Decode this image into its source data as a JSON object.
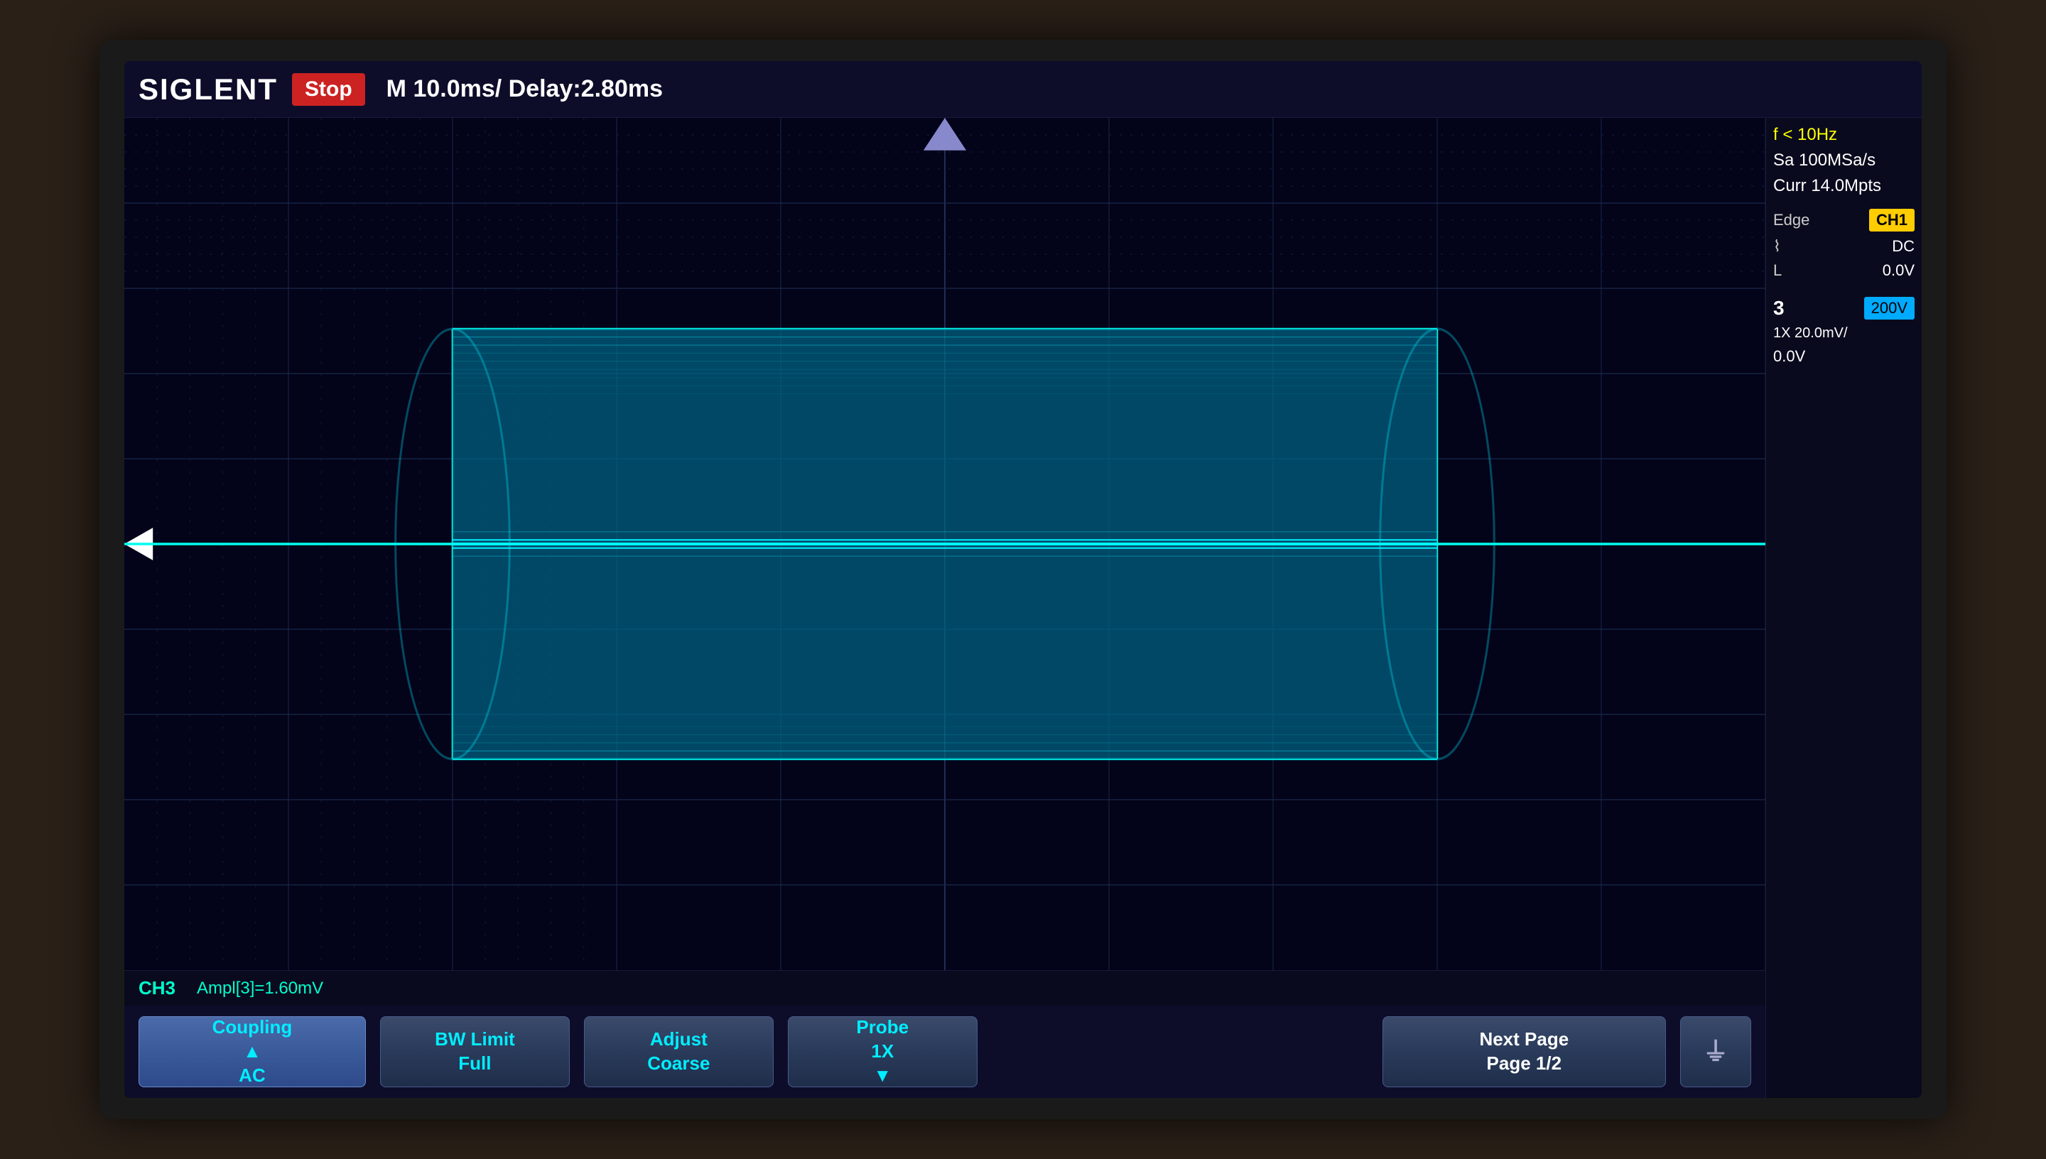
{
  "header": {
    "brand": "SIGLENT",
    "stop_label": "Stop",
    "time_base": "M 10.0ms/ Delay:2.80ms"
  },
  "side_panel": {
    "freq": "f < 10Hz",
    "sa": "Sa 100MSa/s",
    "curr": "Curr 14.0Mpts",
    "edge_label": "Edge",
    "ch1_badge": "CH1",
    "slope_symbol": "⌇",
    "dc_label": "DC",
    "l_label": "L",
    "l_value": "0.0V",
    "ch_number": "3",
    "ch1_highlight": "200V",
    "probe_label": "1X  20.0mV/",
    "offset_value": "0.0V"
  },
  "status_bar": {
    "ch3": "CH3",
    "ampl": "Ampl[3]=1.60mV"
  },
  "buttons": [
    {
      "id": "coupling",
      "line1": "Coupling",
      "line2": "AC",
      "active": true
    },
    {
      "id": "bw-limit",
      "line1": "BW Limit",
      "line2": "Full",
      "active": false
    },
    {
      "id": "adjust-coarse",
      "line1": "Adjust",
      "line2": "Coarse",
      "active": false
    },
    {
      "id": "probe",
      "line1": "Probe",
      "line2": "1X",
      "active": false
    },
    {
      "id": "next-page",
      "line1": "Next Page",
      "line2": "Page 1/2",
      "active": false
    }
  ],
  "icons": {
    "probe_arrow": "▼",
    "ground_symbol": "⏚",
    "trigger_arrow": "▷",
    "delay_triangle": "▼"
  }
}
